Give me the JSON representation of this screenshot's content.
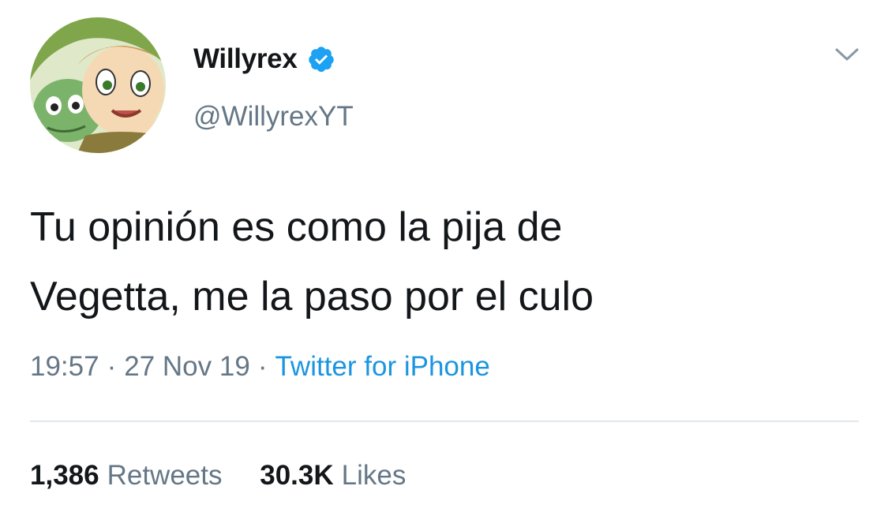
{
  "user": {
    "display_name": "Willyrex",
    "handle": "@WillyrexYT",
    "verified": true
  },
  "tweet": {
    "text_lines": [
      "Tu opinión es como la pija de",
      "Vegetta, me la paso por el culo"
    ],
    "time": "19:57",
    "separator": "·",
    "date": "27 Nov 19",
    "source": "Twitter for iPhone"
  },
  "stats": {
    "retweets_count": "1,386",
    "retweets_label": "Retweets",
    "likes_count": "30.3K",
    "likes_label": "Likes"
  },
  "icons": {
    "verified": "verified-badge-icon",
    "menu": "chevron-down-icon"
  },
  "colors": {
    "verified": "#1da1f2",
    "link": "#1b95e0",
    "secondary_text": "#657786",
    "primary_text": "#14171a",
    "divider": "#e1e8ed"
  }
}
